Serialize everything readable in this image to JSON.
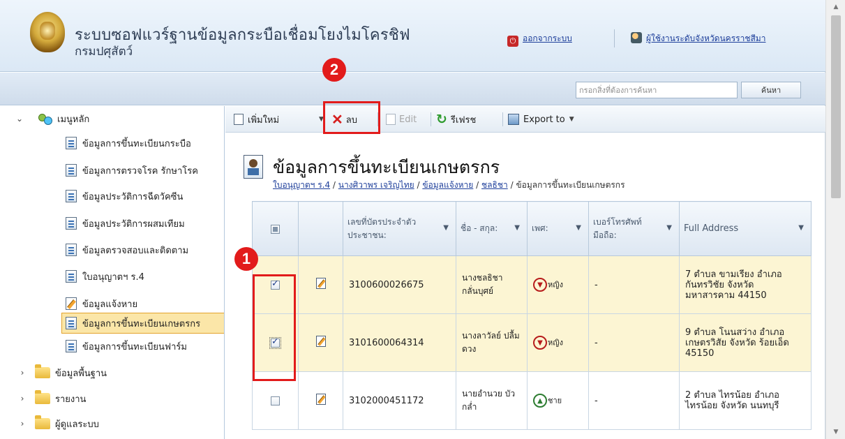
{
  "header": {
    "title": "ระบบซอฟแวร์ฐานข้อมูลกระบือเชื่อมโยงไมโครชิฟ",
    "subtitle": "กรมปศุสัตว์",
    "logout_label": "ออกจากระบบ",
    "user_label": "ผู้ใช้งานระดับจังหวัดนครราชสีมา"
  },
  "search": {
    "placeholder": "กรอกสิ่งที่ต้องการค้นหา",
    "button_label": "ค้นหา"
  },
  "badges": {
    "one": "1",
    "two": "2"
  },
  "sidebar": {
    "root_label": "เมนูหลัก",
    "items": [
      {
        "label": "ข้อมูลการขึ้นทะเบียนกระบือ"
      },
      {
        "label": "ข้อมูลการตรวจโรค รักษาโรค"
      },
      {
        "label": "ข้อมูลประวัติการฉีดวัคซีน"
      },
      {
        "label": "ข้อมูลประวัติการผสมเทียม"
      },
      {
        "label": "ข้อมูลตรวจสอบและติดตาม"
      },
      {
        "label": "ใบอนุญาตฯ ร.4"
      },
      {
        "label": "ข้อมูลแจ้งหาย"
      },
      {
        "label": "ข้อมูลการขึ้นทะเบียนเกษตรกร"
      },
      {
        "label": "ข้อมูลการขึ้นทะเบียนฟาร์ม"
      }
    ],
    "folders": [
      {
        "label": "ข้อมูลพื้นฐาน"
      },
      {
        "label": "รายงาน"
      },
      {
        "label": "ผู้ดูแลระบบ"
      }
    ]
  },
  "toolbar": {
    "new_label": "เพิ่มใหม่",
    "delete_label": "ลบ",
    "edit_label": "Edit",
    "refresh_label": "รีเฟรช",
    "export_label": "Export to"
  },
  "page": {
    "title": "ข้อมูลการขึ้นทะเบียนเกษตรกร",
    "breadcrumb": [
      {
        "label": "ใบอนุญาตฯ ร.4"
      },
      {
        "label": "นางศิวาพร เจริญไทย"
      },
      {
        "label": "ข้อมูลแจ้งหาย"
      },
      {
        "label": "ชลธิชา"
      }
    ],
    "breadcrumb_current": "ข้อมูลการขึ้นทะเบียนเกษตรกร",
    "breadcrumb_sep": "/"
  },
  "grid": {
    "columns": {
      "id_card": "เลขที่บัตรประจำตัวประชาชน:",
      "name": "ชื่อ - สกุล:",
      "gender": "เพศ:",
      "phone": "เบอร์โทรศัพท์มือถือ:",
      "address": "Full Address"
    },
    "rows": [
      {
        "checked": true,
        "id_card": "3100600026675",
        "name": "นางชลธิชา กลั่นบุศย์",
        "gender": "หญิง",
        "phone": "-",
        "address": "7 ตำบล ขามเรียง อำเภอ กันทรวิชัย จังหวัด มหาสารคาม 44150"
      },
      {
        "checked": true,
        "id_card": "3101600064314",
        "name": "นางลาวัลย์ ปลื้มดวง",
        "gender": "หญิง",
        "phone": "-",
        "address": "9 ตำบล โนนสว่าง อำเภอ เกษตรวิสัย จังหวัด ร้อยเอ็ด 45150"
      },
      {
        "checked": false,
        "id_card": "3102000451172",
        "name": "นายอำนวย บัวกล่ำ",
        "gender": "ชาย",
        "phone": "-",
        "address": "2 ตำบล ไทรน้อย อำเภอ ไทรน้อย จังหวัด นนทบุรี"
      }
    ]
  },
  "colors": {
    "accent_red": "#e21b1b",
    "header_bg": "#dbe8f5",
    "selected_row": "#fcf5d3",
    "link_blue": "#1d3e9a"
  }
}
